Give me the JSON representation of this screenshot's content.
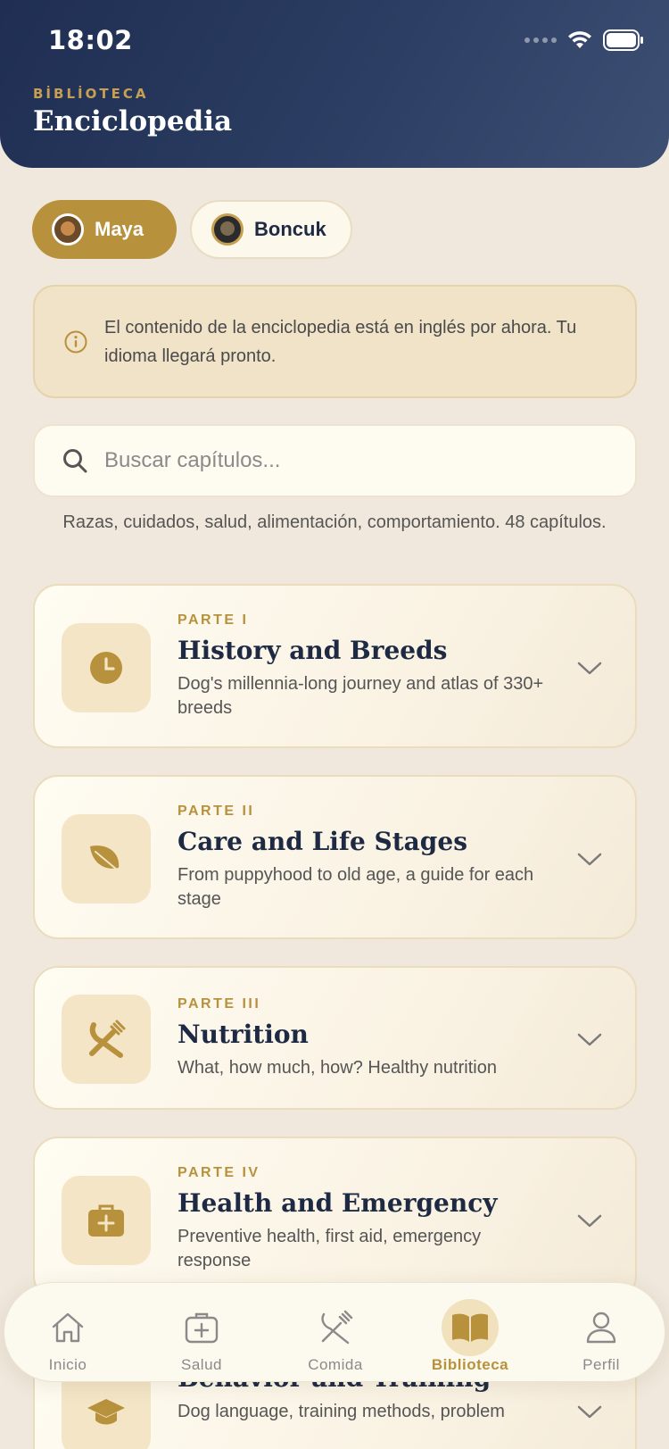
{
  "status_bar": {
    "time": "18:02"
  },
  "header": {
    "eyebrow": "BİBLİOTECA",
    "title": "Enciclopedia"
  },
  "pets": [
    {
      "name": "Maya",
      "selected": true
    },
    {
      "name": "Boncuk",
      "selected": false
    }
  ],
  "notice": {
    "icon": "info-icon",
    "text": "El contenido de la enciclopedia está en inglés por ahora. Tu idioma llegará pronto."
  },
  "search": {
    "placeholder": "Buscar capítulos...",
    "value": ""
  },
  "hint": "Razas, cuidados, salud, alimentación, comportamiento. 48 capítulos.",
  "parts": [
    {
      "label": "PARTE I",
      "title": "History and Breeds",
      "desc": "Dog's millennia-long journey and atlas of 330+ breeds",
      "icon": "clock-icon"
    },
    {
      "label": "PARTE II",
      "title": "Care and Life Stages",
      "desc": "From puppyhood to old age, a guide for each stage",
      "icon": "leaf-icon"
    },
    {
      "label": "PARTE III",
      "title": "Nutrition",
      "desc": "What, how much, how? Healthy nutrition",
      "icon": "utensils-icon"
    },
    {
      "label": "PARTE IV",
      "title": "Health and Emergency",
      "desc": "Preventive health, first aid, emergency response",
      "icon": "medical-kit-icon"
    },
    {
      "label": "",
      "title": "Behavior and Training",
      "desc": "Dog language, training methods, problem",
      "icon": "graduation-cap-icon"
    }
  ],
  "tabs": [
    {
      "label": "Inicio",
      "icon": "home-icon",
      "active": false
    },
    {
      "label": "Salud",
      "icon": "medical-icon",
      "active": false
    },
    {
      "label": "Comida",
      "icon": "utensils-icon",
      "active": false
    },
    {
      "label": "Biblioteca",
      "icon": "book-icon",
      "active": true
    },
    {
      "label": "Perfil",
      "icon": "person-icon",
      "active": false
    }
  ],
  "colors": {
    "navy": "#1f2e52",
    "gold": "#b8913d",
    "background": "#f0e8dc"
  }
}
